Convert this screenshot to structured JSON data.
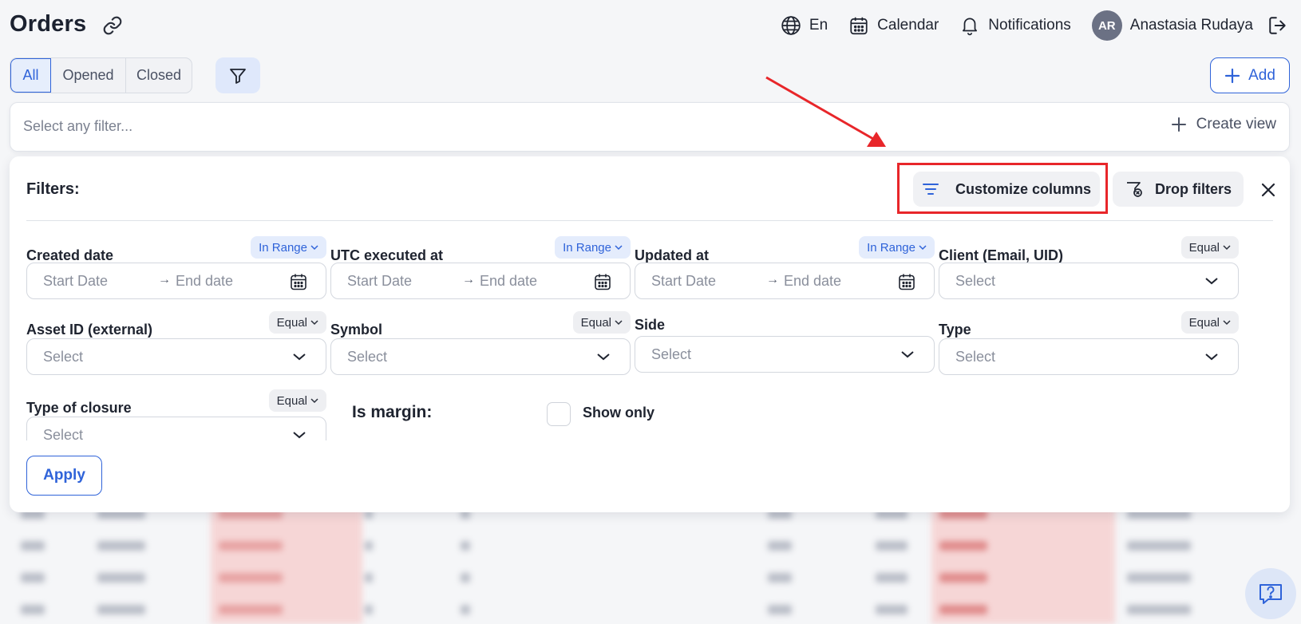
{
  "header": {
    "title": "Orders",
    "language": "En",
    "calendar": "Calendar",
    "notifications": "Notifications",
    "user": {
      "initials": "AR",
      "name": "Anastasia Rudaya"
    }
  },
  "tabs": [
    {
      "label": "All",
      "active": true
    },
    {
      "label": "Opened",
      "active": false
    },
    {
      "label": "Closed",
      "active": false
    }
  ],
  "toolbar": {
    "add_label": "Add"
  },
  "search": {
    "placeholder": "Select any filter...",
    "create_view": "Create view"
  },
  "filters": {
    "title": "Filters:",
    "customize_columns": "Customize columns",
    "drop_filters": "Drop filters",
    "apply": "Apply",
    "fields": {
      "created_date": {
        "label": "Created date",
        "mode": "In Range",
        "start": "Start Date",
        "arrow": "→",
        "end": "End date"
      },
      "utc_executed": {
        "label": "UTC executed at",
        "mode": "In Range",
        "start": "Start Date",
        "arrow": "→",
        "end": "End date"
      },
      "updated_at": {
        "label": "Updated at",
        "mode": "In Range",
        "start": "Start Date",
        "arrow": "→",
        "end": "End date"
      },
      "client": {
        "label": "Client (Email, UID)",
        "mode": "Equal",
        "value": "Select"
      },
      "asset_id": {
        "label": "Asset ID (external)",
        "mode": "Equal",
        "value": "Select"
      },
      "symbol": {
        "label": "Symbol",
        "mode": "Equal",
        "value": "Select"
      },
      "side": {
        "label": "Side",
        "value": "Select"
      },
      "type": {
        "label": "Type",
        "mode": "Equal",
        "value": "Select"
      },
      "type_of_closure": {
        "label": "Type of closure",
        "mode": "Equal",
        "value": "Select"
      },
      "is_margin": {
        "label": "Is margin:",
        "option": "Show only",
        "checked": false
      }
    }
  },
  "colors": {
    "accent": "#2f63d9",
    "highlight": "#e8262a",
    "avatar": "#6b7184"
  }
}
